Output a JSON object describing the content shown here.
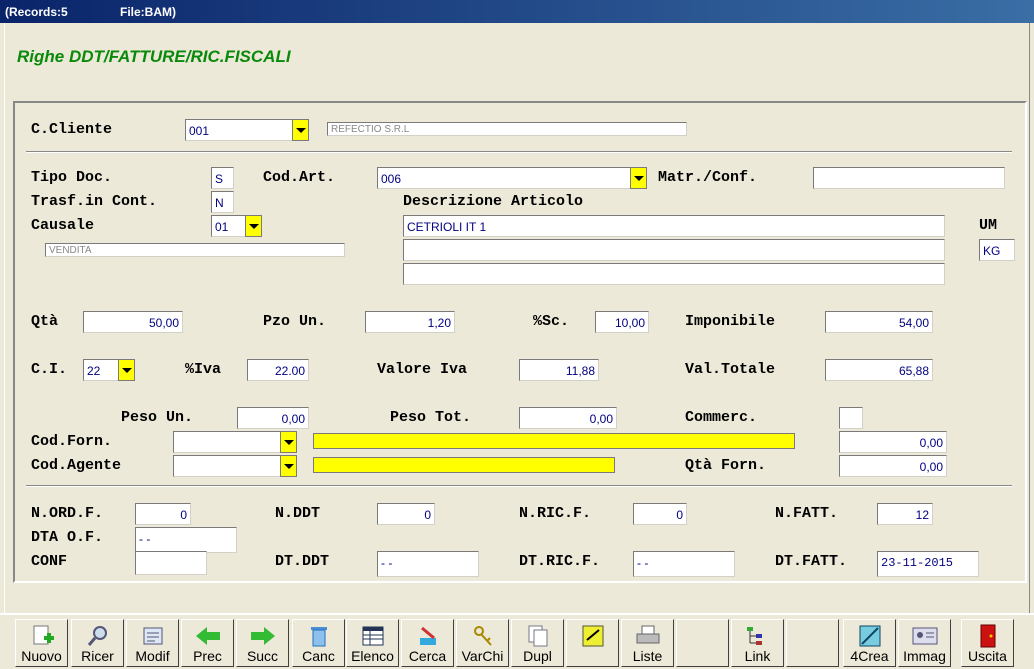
{
  "titlebar": {
    "records": "(Records:5",
    "file": "File:BAM)"
  },
  "form_title": "Righe DDT/FATTURE/RIC.FISCALI",
  "labels": {
    "cliente": "C.Cliente",
    "tipo_doc": "Tipo Doc.",
    "cod_art": "Cod.Art.",
    "matr_conf": "Matr./Conf.",
    "trasf": "Trasf.in Cont.",
    "descr_art": "Descrizione Articolo",
    "causale": "Causale",
    "um": "UM",
    "qta": "Qtà",
    "pzo_un": "Pzo Un.",
    "sconto": "%Sc.",
    "imponibile": "Imponibile",
    "ci": "C.I.",
    "iva": "%Iva",
    "valore_iva": "Valore Iva",
    "val_totale": "Val.Totale",
    "peso_un": "Peso Un.",
    "peso_tot": "Peso Tot.",
    "commerc": "Commerc.",
    "cod_forn": "Cod.Forn.",
    "cod_agente": "Cod.Agente",
    "qta_forn": "Qtà Forn.",
    "n_ord_f": "N.ORD.F.",
    "n_ddt": "N.DDT",
    "n_ric_f": "N.RIC.F.",
    "n_fatt": "N.FATT.",
    "dta_of": "DTA O.F.",
    "conf": "CONF",
    "dt_ddt": "DT.DDT",
    "dt_ric_f": "DT.RIC.F.",
    "dt_fatt": "DT.FATT."
  },
  "values": {
    "cliente_code": "001",
    "cliente_name": "REFECTIO S.R.L",
    "tipo_doc": "S",
    "cod_art": "006",
    "matr_conf": "",
    "trasf": "N",
    "causale_code": "01",
    "causale_name": "VENDITA",
    "descr_1": "CETRIOLI  IT 1",
    "descr_2": "",
    "descr_3": "",
    "um": "KG",
    "qta": "50,00",
    "pzo_un": "1,20",
    "sconto": "10,00",
    "imponibile": "54,00",
    "ci": "22",
    "iva": "22.00",
    "valore_iva": "11,88",
    "val_totale": "65,88",
    "peso_un": "0,00",
    "peso_tot": "0,00",
    "commerc": "",
    "cod_forn": "",
    "forn_amount": "0,00",
    "cod_agente": "",
    "qta_forn": "0,00",
    "n_ord_f": "0",
    "n_ddt": "0",
    "n_ric_f": "0",
    "n_fatt": "12",
    "dta_of": "  -   -",
    "dt_ddt": "  -   -",
    "dt_ric_f": "  -   -",
    "dt_fatt": "23-11-2015"
  },
  "toolbar": [
    {
      "label": "Nuovo",
      "icon": "new-document-icon"
    },
    {
      "label": "Ricer",
      "icon": "magnifier-icon"
    },
    {
      "label": "Modif",
      "icon": "edit-document-icon"
    },
    {
      "label": "Prec",
      "icon": "arrow-left-icon"
    },
    {
      "label": "Succ",
      "icon": "arrow-right-icon"
    },
    {
      "label": "Canc",
      "icon": "trash-icon"
    },
    {
      "label": "Elenco",
      "icon": "table-icon"
    },
    {
      "label": "Cerca",
      "icon": "search-pencil-icon"
    },
    {
      "label": "VarChi",
      "icon": "keys-icon"
    },
    {
      "label": "Dupl",
      "icon": "duplicate-icon"
    },
    {
      "label": "",
      "icon": "note-icon"
    },
    {
      "label": "Liste",
      "icon": "printer-icon"
    },
    {
      "label": "",
      "icon": ""
    },
    {
      "label": "Link",
      "icon": "tree-icon"
    },
    {
      "label": "",
      "icon": ""
    },
    {
      "label": "4Crea",
      "icon": "crea-icon"
    },
    {
      "label": "Immag",
      "icon": "id-card-icon"
    },
    {
      "label": "Uscita",
      "icon": "exit-door-icon"
    }
  ],
  "colors": {
    "title_green": "#0a8a0a",
    "field_text": "#000080",
    "highlight_yellow": "#ffff00"
  }
}
